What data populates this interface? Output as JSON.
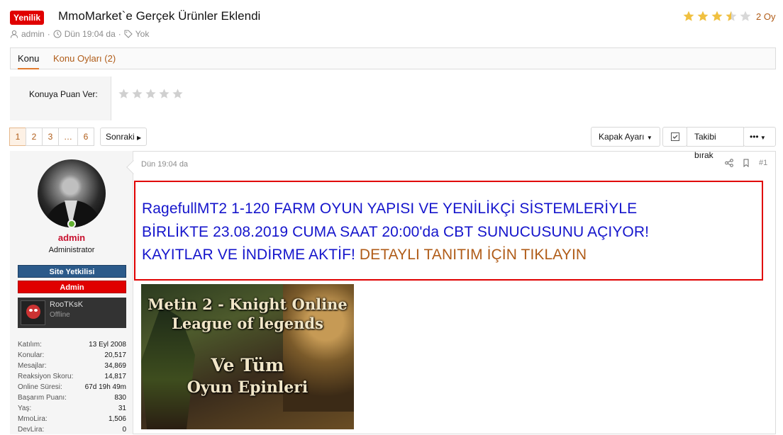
{
  "header": {
    "badge": "Yenilik",
    "title": "MmoMarket`e Gerçek Ürünler Eklendi",
    "author": "admin",
    "date": "Dün 19:04 da",
    "tags": "Yok",
    "rating_value": 3.5,
    "rating_max": 5,
    "votes": "2 Oy",
    "star_color": "#f0c040"
  },
  "tabs": [
    {
      "label": "Konu",
      "active": true
    },
    {
      "label": "Konu Oyları (2)",
      "active": false
    }
  ],
  "rate": {
    "label": "Konuya Puan Ver:"
  },
  "pagination": {
    "pages": [
      "1",
      "2",
      "3",
      "…",
      "6"
    ],
    "current": "1",
    "next_label": "Sonraki"
  },
  "toolbar": {
    "cover_label": "Kapak Ayarı",
    "unwatch_label": "Takibi bırak",
    "more_label": "•••"
  },
  "user": {
    "name": "admin",
    "title": "Administrator",
    "banner_staff": "Site Yetkilisi",
    "banner_admin": "Admin",
    "card_name": "RooTKsK",
    "card_status": "Offline",
    "stats": [
      {
        "k": "Katılım:",
        "v": "13 Eyl 2008"
      },
      {
        "k": "Konular:",
        "v": "20,517"
      },
      {
        "k": "Mesajlar:",
        "v": "34,869"
      },
      {
        "k": "Reaksiyon Skoru:",
        "v": "14,817"
      },
      {
        "k": "Online Süresi:",
        "v": "67d 19h 49m"
      },
      {
        "k": "Başarım Puanı:",
        "v": "830"
      },
      {
        "k": "Yaş:",
        "v": "31"
      },
      {
        "k": "MmoLira:",
        "v": "1,506"
      },
      {
        "k": "DevLira:",
        "v": "0"
      }
    ]
  },
  "post": {
    "date": "Dün 19:04 da",
    "number": "#1",
    "line1": "RagefullMT2 1-120 FARM OYUN YAPISI VE YENİLİKÇİ SİSTEMLERİYLE",
    "line2": "BİRLİKTE 23.08.2019 CUMA SAAT 20:00'da CBT SUNUCUSUNU AÇIYOR!",
    "line3": "KAYITLAR VE İNDİRME AKTİF! ",
    "link": "DETAYLI TANITIM İÇİN TIKLAYIN",
    "text_color": "#1515cc",
    "link_color": "#b05c18",
    "box_color": "#e00000"
  },
  "promo": {
    "line1": "Metin 2 - Knight Online",
    "line2": "League of legends",
    "line3": "Ve Tüm",
    "line4": "Oyun Epinleri"
  }
}
